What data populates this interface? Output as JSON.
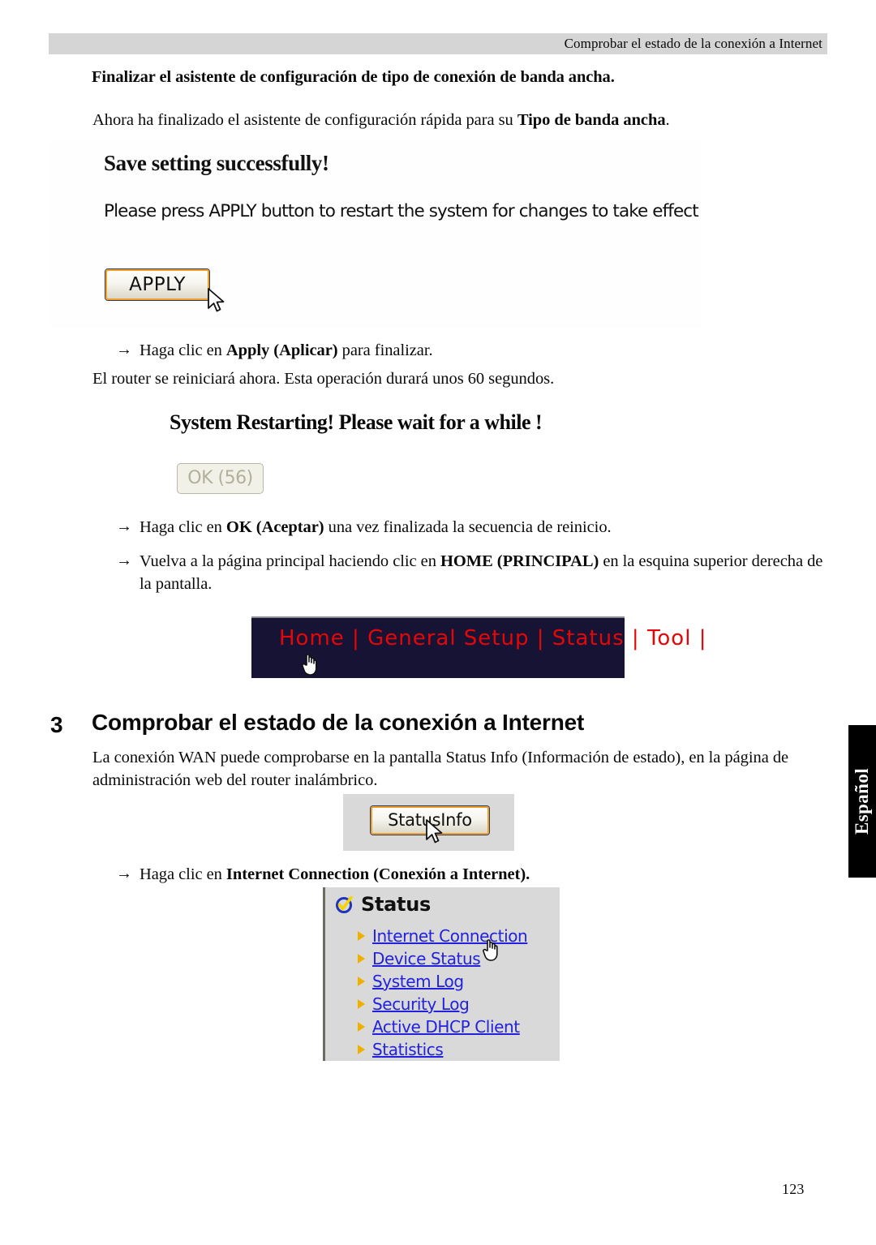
{
  "header": {
    "running_head": "Comprobar el estado de la conexión a Internet"
  },
  "doc": {
    "title": "Finalizar el asistente de configuración de tipo de conexión de banda ancha.",
    "intro_pre": "Ahora ha finalizado el asistente de configuración rápida para su ",
    "intro_bold": "Tipo de banda ancha",
    "intro_post": ".",
    "reboot_note": "El router se reiniciará ahora. Esta operación durará unos 60 segundos."
  },
  "bullets": {
    "arrow_glyph": "→",
    "apply": {
      "pre": "Haga clic en ",
      "bold": "Apply (Aplicar)",
      "post": " para finalizar."
    },
    "ok": {
      "pre": "Haga clic en ",
      "bold": "OK (Aceptar)",
      "post": " una vez finalizada la secuencia de reinicio."
    },
    "home": {
      "pre": "Vuelva a la página principal haciendo clic en ",
      "bold": "HOME (PRINCIPAL)",
      "post": " en la esquina superior derecha de la pantalla."
    },
    "internet": {
      "pre": "Haga clic en ",
      "bold": "Internet Connection (Conexión a Internet)",
      "post": "."
    }
  },
  "save_screenshot": {
    "heading": "Save setting successfully!",
    "subtext": "Please press APPLY button to restart the system for changes to take effect",
    "apply_button": "APPLY",
    "cursor": "arrow-cursor"
  },
  "restart_screenshot": {
    "heading": "System Restarting! Please wait for a while !",
    "ok_button": "OK (56)",
    "ok_button_state": "disabled"
  },
  "nav_screenshot": {
    "items": [
      "Home",
      "General Setup",
      "Status",
      "Tool"
    ],
    "separator": "|",
    "text_color": "#e50707",
    "background_color": "#171334",
    "cursor": "hand-cursor"
  },
  "section": {
    "number": "3",
    "title": "Comprobar el estado de la conexión a Internet",
    "paragraph": "La conexión WAN puede comprobarse en la pantalla Status Info (Información de estado), en la página de administración web del router inalámbrico."
  },
  "statusinfo_screenshot": {
    "button_label": "StatusInfo",
    "cursor": "arrow-cursor"
  },
  "status_menu": {
    "title": "Status",
    "title_icon": "status-check-icon",
    "items": [
      {
        "label": "Internet Connection"
      },
      {
        "label": "Device Status"
      },
      {
        "label": "System Log"
      },
      {
        "label": "Security Log"
      },
      {
        "label": "Active DHCP Client"
      },
      {
        "label": "Statistics"
      }
    ],
    "link_color": "#2222dd",
    "bullet_color": "#f0b000",
    "cursor": "hand-cursor"
  },
  "language_tab": {
    "label": "Español"
  },
  "footer": {
    "page_number": "123"
  }
}
